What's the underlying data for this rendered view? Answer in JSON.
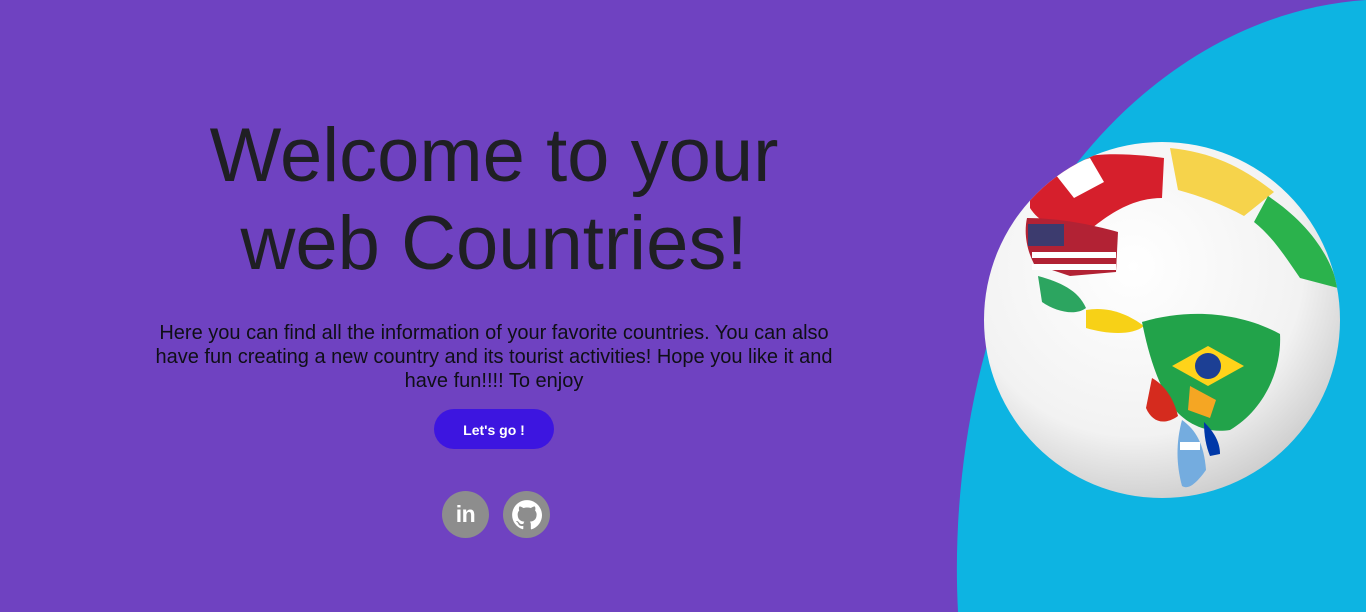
{
  "page": {
    "background_color": "#6f42c1",
    "accent_shape_color": "#0db4e2"
  },
  "hero": {
    "title_line_1": "Welcome to your",
    "title_line_2": "web Countries!",
    "description": "Here you can find all the information of your favorite countries. You can also have fun creating a new country and its tourist activities! Hope you like it and have fun!!!! To enjoy",
    "cta_label": "Let's go !",
    "cta_color": "#3d15e0"
  },
  "socials": {
    "items": [
      {
        "name": "linkedin",
        "label": "in",
        "icon": "linkedin-icon"
      },
      {
        "name": "github",
        "label": "",
        "icon": "github-icon"
      }
    ],
    "icon_color": "#8d8d8d"
  },
  "illustration": {
    "name": "world-flags-globe"
  }
}
